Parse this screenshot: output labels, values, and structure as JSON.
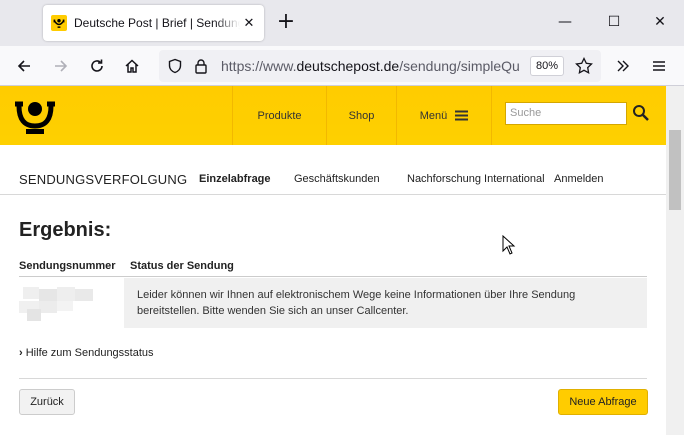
{
  "browser": {
    "tab_title": "Deutsche Post | Brief | Sendungsverfolgung",
    "url_prefix": "https://www.",
    "url_domain": "deutschepost.de",
    "url_path": "/sendung/simpleQu",
    "zoom": "80%"
  },
  "header": {
    "nav": [
      "Produkte",
      "Shop",
      "Menü"
    ],
    "search_placeholder": "Suche"
  },
  "subnav": {
    "title": "SENDUNGSVERFOLGUNG",
    "items": [
      "Einzelabfrage",
      "Geschäftskunden",
      "Nachforschung International",
      "Anmelden"
    ]
  },
  "result": {
    "title": "Ergebnis:",
    "col_number": "Sendungsnummer",
    "col_status": "Status der Sendung",
    "status_text": "Leider können wir Ihnen auf elektronischem Wege keine Informationen über Ihre Sendung bereitstellen. Bitte wenden Sie sich an unser Callcenter.",
    "help_link": "Hilfe zum Sendungsstatus"
  },
  "buttons": {
    "back": "Zurück",
    "new_query": "Neue Abfrage"
  },
  "colors": {
    "brand_yellow": "#ffcc00"
  }
}
